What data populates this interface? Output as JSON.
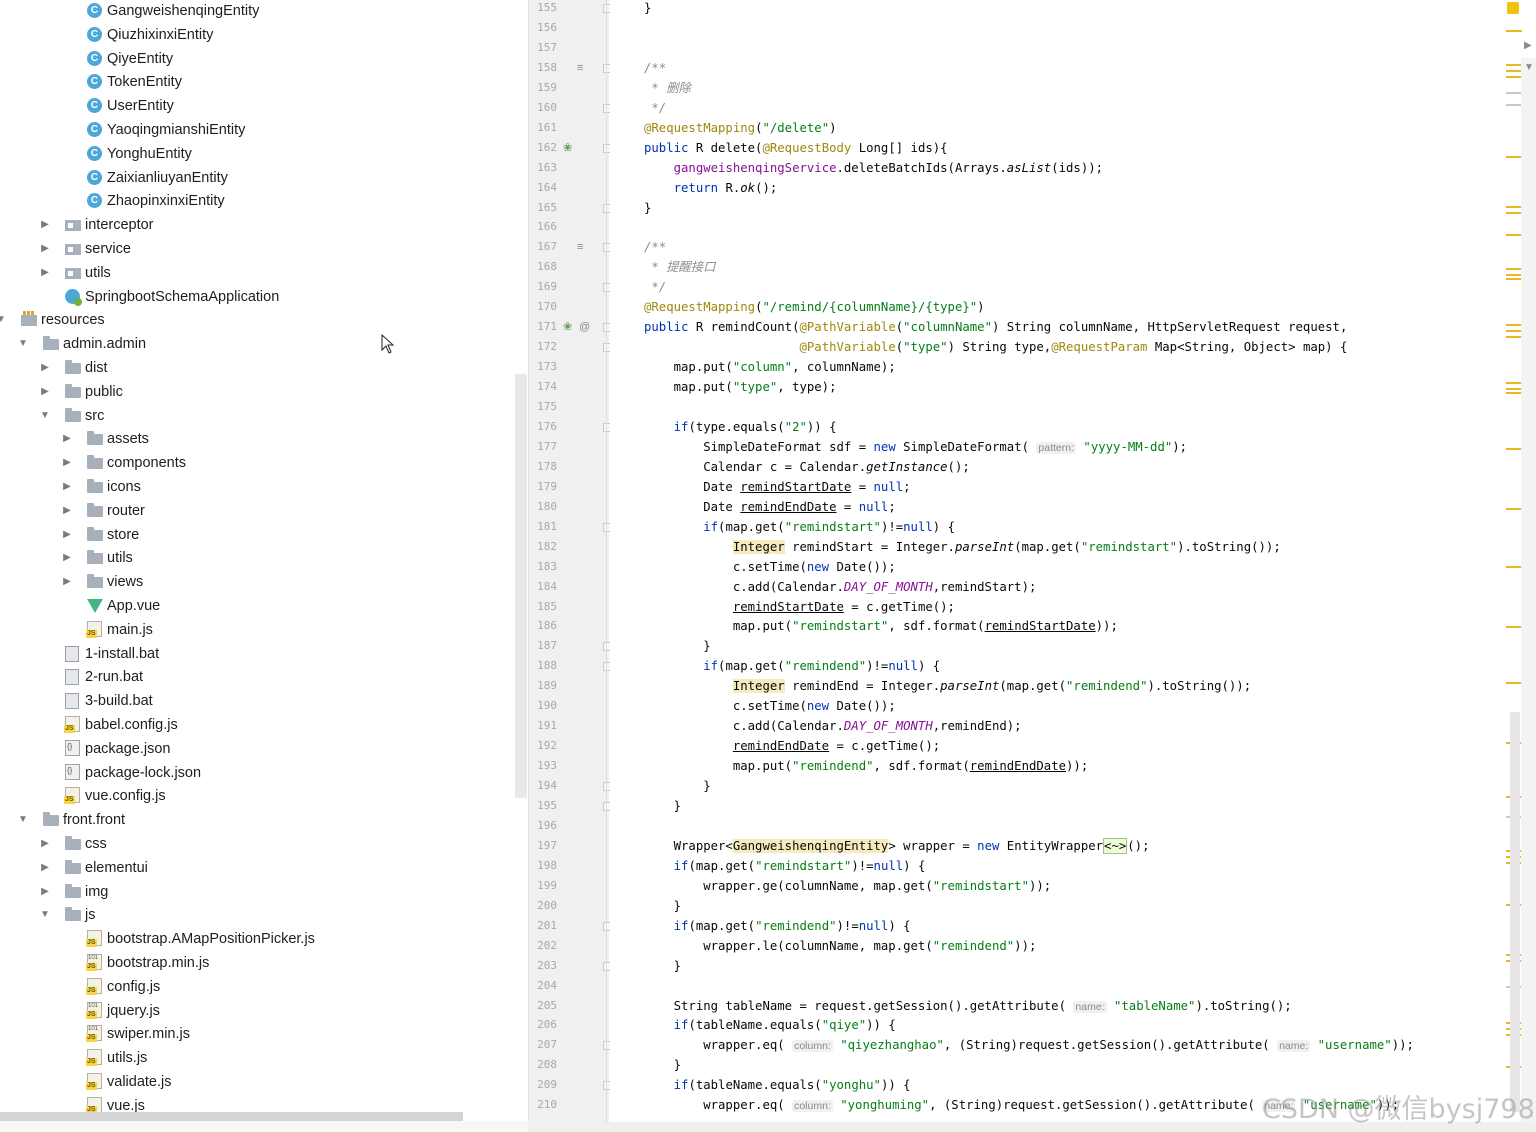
{
  "tree": {
    "rows": [
      {
        "label": "GangweishenqingEntity",
        "icon": "class-icon",
        "indent": 2,
        "arrow": ""
      },
      {
        "label": "QiuzhixinxiEntity",
        "icon": "class-icon",
        "indent": 2,
        "arrow": ""
      },
      {
        "label": "QiyeEntity",
        "icon": "class-icon",
        "indent": 2,
        "arrow": ""
      },
      {
        "label": "TokenEntity",
        "icon": "class-icon",
        "indent": 2,
        "arrow": ""
      },
      {
        "label": "UserEntity",
        "icon": "class-icon",
        "indent": 2,
        "arrow": ""
      },
      {
        "label": "YaoqingmianshiEntity",
        "icon": "class-icon",
        "indent": 2,
        "arrow": ""
      },
      {
        "label": "YonghuEntity",
        "icon": "class-icon",
        "indent": 2,
        "arrow": ""
      },
      {
        "label": "ZaixianliuyanEntity",
        "icon": "class-icon",
        "indent": 2,
        "arrow": ""
      },
      {
        "label": "ZhaopinxinxiEntity",
        "icon": "class-icon",
        "indent": 2,
        "arrow": ""
      },
      {
        "label": "interceptor",
        "icon": "package-icon",
        "indent": 1,
        "arrow": "collapsed"
      },
      {
        "label": "service",
        "icon": "package-icon",
        "indent": 1,
        "arrow": "collapsed"
      },
      {
        "label": "utils",
        "icon": "package-icon",
        "indent": 1,
        "arrow": "collapsed"
      },
      {
        "label": "SpringbootSchemaApplication",
        "icon": "spring-app-icon",
        "indent": 1,
        "arrow": ""
      },
      {
        "label": "resources",
        "icon": "resources-folder-icon",
        "indent": -1,
        "arrow": "expanded"
      },
      {
        "label": "admin.admin",
        "icon": "folder-icon",
        "indent": 0,
        "arrow": "expanded"
      },
      {
        "label": "dist",
        "icon": "folder-icon",
        "indent": 1,
        "arrow": "collapsed"
      },
      {
        "label": "public",
        "icon": "folder-icon",
        "indent": 1,
        "arrow": "collapsed"
      },
      {
        "label": "src",
        "icon": "folder-icon",
        "indent": 1,
        "arrow": "expanded"
      },
      {
        "label": "assets",
        "icon": "folder-icon",
        "indent": 2,
        "arrow": "collapsed"
      },
      {
        "label": "components",
        "icon": "folder-icon",
        "indent": 2,
        "arrow": "collapsed"
      },
      {
        "label": "icons",
        "icon": "folder-icon",
        "indent": 2,
        "arrow": "collapsed"
      },
      {
        "label": "router",
        "icon": "folder-icon",
        "indent": 2,
        "arrow": "collapsed"
      },
      {
        "label": "store",
        "icon": "folder-icon",
        "indent": 2,
        "arrow": "collapsed"
      },
      {
        "label": "utils",
        "icon": "folder-icon",
        "indent": 2,
        "arrow": "collapsed"
      },
      {
        "label": "views",
        "icon": "folder-icon",
        "indent": 2,
        "arrow": "collapsed"
      },
      {
        "label": "App.vue",
        "icon": "vue-file-icon",
        "indent": 2,
        "arrow": ""
      },
      {
        "label": "main.js",
        "icon": "js-file-icon",
        "indent": 2,
        "arrow": ""
      },
      {
        "label": "1-install.bat",
        "icon": "bat-file-icon",
        "indent": 1,
        "arrow": ""
      },
      {
        "label": "2-run.bat",
        "icon": "bat-file-icon",
        "indent": 1,
        "arrow": ""
      },
      {
        "label": "3-build.bat",
        "icon": "bat-file-icon",
        "indent": 1,
        "arrow": ""
      },
      {
        "label": "babel.config.js",
        "icon": "js-file-icon",
        "indent": 1,
        "arrow": ""
      },
      {
        "label": "package.json",
        "icon": "json-file-icon",
        "indent": 1,
        "arrow": ""
      },
      {
        "label": "package-lock.json",
        "icon": "json-file-icon",
        "indent": 1,
        "arrow": ""
      },
      {
        "label": "vue.config.js",
        "icon": "js-file-icon",
        "indent": 1,
        "arrow": ""
      },
      {
        "label": "front.front",
        "icon": "folder-icon",
        "indent": 0,
        "arrow": "expanded"
      },
      {
        "label": "css",
        "icon": "folder-icon",
        "indent": 1,
        "arrow": "collapsed"
      },
      {
        "label": "elementui",
        "icon": "folder-icon",
        "indent": 1,
        "arrow": "collapsed"
      },
      {
        "label": "img",
        "icon": "folder-icon",
        "indent": 1,
        "arrow": "collapsed"
      },
      {
        "label": "js",
        "icon": "folder-icon",
        "indent": 1,
        "arrow": "expanded"
      },
      {
        "label": "bootstrap.AMapPositionPicker.js",
        "icon": "js-file-icon",
        "indent": 2,
        "arrow": ""
      },
      {
        "label": "bootstrap.min.js",
        "icon": "minified-js-icon",
        "indent": 2,
        "arrow": ""
      },
      {
        "label": "config.js",
        "icon": "js-file-icon",
        "indent": 2,
        "arrow": ""
      },
      {
        "label": "jquery.js",
        "icon": "minified-js-icon",
        "indent": 2,
        "arrow": ""
      },
      {
        "label": "swiper.min.js",
        "icon": "minified-js-icon",
        "indent": 2,
        "arrow": ""
      },
      {
        "label": "utils.js",
        "icon": "js-file-icon",
        "indent": 2,
        "arrow": ""
      },
      {
        "label": "validate.js",
        "icon": "js-file-icon",
        "indent": 2,
        "arrow": ""
      },
      {
        "label": "vue.js",
        "icon": "js-file-icon",
        "indent": 2,
        "arrow": ""
      }
    ]
  },
  "editor": {
    "line_numbers": [
      "155",
      "156",
      "157",
      "158",
      "159",
      "160",
      "161",
      "162",
      "163",
      "164",
      "165",
      "166",
      "167",
      "168",
      "169",
      "170",
      "171",
      "172",
      "173",
      "174",
      "175",
      "176",
      "177",
      "178",
      "179",
      "180",
      "181",
      "182",
      "183",
      "184",
      "185",
      "186",
      "187",
      "188",
      "189",
      "190",
      "191",
      "192",
      "193",
      "194",
      "195",
      "196",
      "197",
      "198",
      "199",
      "200",
      "201",
      "202",
      "203",
      "204",
      "205",
      "206",
      "207",
      "208",
      "209",
      "210"
    ],
    "gutter_marks": {
      "158": "doc-icon",
      "162": "bean-icon",
      "167": "doc-icon",
      "171": "bean-icon"
    },
    "lines": [
      [
        [
          "}",
          ""
        ]
      ],
      [],
      [],
      [
        [
          "/**",
          "cm"
        ]
      ],
      [
        [
          " * 删除",
          "cm"
        ]
      ],
      [
        [
          " */",
          "cm"
        ]
      ],
      [
        [
          "@RequestMapping",
          "an"
        ],
        [
          "(",
          ""
        ],
        [
          "\"/delete\"",
          "st"
        ],
        [
          ")",
          ""
        ]
      ],
      [
        [
          "public ",
          "kw"
        ],
        [
          "R delete(",
          ""
        ],
        [
          "@RequestBody ",
          "an"
        ],
        [
          "Long[] ids){",
          ""
        ]
      ],
      [
        [
          "    ",
          ""
        ],
        [
          "gangweishenqingService",
          "fd"
        ],
        [
          ".deleteBatchIds(Arrays.",
          ""
        ],
        [
          "asList",
          "it"
        ],
        [
          "(ids));",
          ""
        ]
      ],
      [
        [
          "    ",
          ""
        ],
        [
          "return ",
          "kw"
        ],
        [
          "R.",
          ""
        ],
        [
          "ok",
          "it"
        ],
        [
          "();",
          ""
        ]
      ],
      [
        [
          "}",
          ""
        ]
      ],
      [],
      [
        [
          "/**",
          "cm"
        ]
      ],
      [
        [
          " * 提醒接口",
          "cm"
        ]
      ],
      [
        [
          " */",
          "cm"
        ]
      ],
      [
        [
          "@RequestMapping",
          "an"
        ],
        [
          "(",
          ""
        ],
        [
          "\"/remind/{columnName}/{type}\"",
          "st"
        ],
        [
          ")",
          ""
        ]
      ],
      [
        [
          "public ",
          "kw"
        ],
        [
          "R remindCount(",
          ""
        ],
        [
          "@PathVariable",
          "an"
        ],
        [
          "(",
          ""
        ],
        [
          "\"columnName\"",
          "st"
        ],
        [
          ") String columnName, HttpServletRequest request,",
          ""
        ]
      ],
      [
        [
          "                     ",
          ""
        ],
        [
          "@PathVariable",
          "an"
        ],
        [
          "(",
          ""
        ],
        [
          "\"type\"",
          "st"
        ],
        [
          ") String type,",
          ""
        ],
        [
          "@RequestParam ",
          "an"
        ],
        [
          "Map<String, Object> map) {",
          ""
        ]
      ],
      [
        [
          "    map.put(",
          ""
        ],
        [
          "\"column\"",
          "st"
        ],
        [
          ", columnName);",
          ""
        ]
      ],
      [
        [
          "    map.put(",
          ""
        ],
        [
          "\"type\"",
          "st"
        ],
        [
          ", type);",
          ""
        ]
      ],
      [],
      [
        [
          "    ",
          ""
        ],
        [
          "if",
          "kw"
        ],
        [
          "(type.equals(",
          ""
        ],
        [
          "\"2\"",
          "st"
        ],
        [
          ")) {",
          ""
        ]
      ],
      [
        [
          "        SimpleDateFormat sdf = ",
          ""
        ],
        [
          "new ",
          "kw"
        ],
        [
          "SimpleDateFormat( ",
          ""
        ],
        [
          "pattern:",
          "hint"
        ],
        [
          " ",
          ""
        ],
        [
          "\"yyyy-MM-dd\"",
          "st"
        ],
        [
          ");",
          ""
        ]
      ],
      [
        [
          "        Calendar c = Calendar.",
          ""
        ],
        [
          "getInstance",
          "it"
        ],
        [
          "();",
          ""
        ]
      ],
      [
        [
          "        Date ",
          ""
        ],
        [
          "remindStartDate",
          "ul"
        ],
        [
          " = ",
          ""
        ],
        [
          "null",
          "kw"
        ],
        [
          ";",
          ""
        ]
      ],
      [
        [
          "        Date ",
          ""
        ],
        [
          "remindEndDate",
          "ul"
        ],
        [
          " = ",
          ""
        ],
        [
          "null",
          "kw"
        ],
        [
          ";",
          ""
        ]
      ],
      [
        [
          "        ",
          ""
        ],
        [
          "if",
          "kw"
        ],
        [
          "(map.get(",
          ""
        ],
        [
          "\"remindstart\"",
          "st"
        ],
        [
          ")!=",
          ""
        ],
        [
          "null",
          "kw"
        ],
        [
          ") {",
          ""
        ]
      ],
      [
        [
          "            ",
          ""
        ],
        [
          "Integer",
          "hl"
        ],
        [
          " remindStart = Integer.",
          ""
        ],
        [
          "parseInt",
          "it"
        ],
        [
          "(map.get(",
          ""
        ],
        [
          "\"remindstart\"",
          "st"
        ],
        [
          ").toString());",
          ""
        ]
      ],
      [
        [
          "            c.setTime(",
          ""
        ],
        [
          "new ",
          "kw"
        ],
        [
          "Date());",
          ""
        ]
      ],
      [
        [
          "            c.add(Calendar.",
          ""
        ],
        [
          "DAY_OF_MONTH",
          "ct"
        ],
        [
          ",remindStart);",
          ""
        ]
      ],
      [
        [
          "            ",
          ""
        ],
        [
          "remindStartDate",
          "ul"
        ],
        [
          " = c.getTime();",
          ""
        ]
      ],
      [
        [
          "            map.put(",
          ""
        ],
        [
          "\"remindstart\"",
          "st"
        ],
        [
          ", sdf.format(",
          ""
        ],
        [
          "remindStartDate",
          "ul"
        ],
        [
          "));",
          ""
        ]
      ],
      [
        [
          "        }",
          ""
        ]
      ],
      [
        [
          "        ",
          ""
        ],
        [
          "if",
          "kw"
        ],
        [
          "(map.get(",
          ""
        ],
        [
          "\"remindend\"",
          "st"
        ],
        [
          ")!=",
          ""
        ],
        [
          "null",
          "kw"
        ],
        [
          ") {",
          ""
        ]
      ],
      [
        [
          "            ",
          ""
        ],
        [
          "Integer",
          "hl"
        ],
        [
          " remindEnd = Integer.",
          ""
        ],
        [
          "parseInt",
          "it"
        ],
        [
          "(map.get(",
          ""
        ],
        [
          "\"remindend\"",
          "st"
        ],
        [
          ").toString());",
          ""
        ]
      ],
      [
        [
          "            c.setTime(",
          ""
        ],
        [
          "new ",
          "kw"
        ],
        [
          "Date());",
          ""
        ]
      ],
      [
        [
          "            c.add(Calendar.",
          ""
        ],
        [
          "DAY_OF_MONTH",
          "ct"
        ],
        [
          ",remindEnd);",
          ""
        ]
      ],
      [
        [
          "            ",
          ""
        ],
        [
          "remindEndDate",
          "ul"
        ],
        [
          " = c.getTime();",
          ""
        ]
      ],
      [
        [
          "            map.put(",
          ""
        ],
        [
          "\"remindend\"",
          "st"
        ],
        [
          ", sdf.format(",
          ""
        ],
        [
          "remindEndDate",
          "ul"
        ],
        [
          "));",
          ""
        ]
      ],
      [
        [
          "        }",
          ""
        ]
      ],
      [
        [
          "    }",
          ""
        ]
      ],
      [],
      [
        [
          "    Wrapper<",
          ""
        ],
        [
          "GangweishenqingEntity",
          "hl"
        ],
        [
          "> wrapper = ",
          ""
        ],
        [
          "new ",
          "kw"
        ],
        [
          "EntityWrapper",
          ""
        ],
        [
          "<~>",
          "typeq"
        ],
        [
          "();",
          ""
        ]
      ],
      [
        [
          "    ",
          ""
        ],
        [
          "if",
          "kw"
        ],
        [
          "(map.get(",
          ""
        ],
        [
          "\"remindstart\"",
          "st"
        ],
        [
          ")!=",
          ""
        ],
        [
          "null",
          "kw"
        ],
        [
          ") {",
          ""
        ]
      ],
      [
        [
          "        wrapper.ge(columnName, map.get(",
          ""
        ],
        [
          "\"remindstart\"",
          "st"
        ],
        [
          "));",
          ""
        ]
      ],
      [
        [
          "    }",
          ""
        ]
      ],
      [
        [
          "    ",
          ""
        ],
        [
          "if",
          "kw"
        ],
        [
          "(map.get(",
          ""
        ],
        [
          "\"remindend\"",
          "st"
        ],
        [
          ")!=",
          ""
        ],
        [
          "null",
          "kw"
        ],
        [
          ") {",
          ""
        ]
      ],
      [
        [
          "        wrapper.le(columnName, map.get(",
          ""
        ],
        [
          "\"remindend\"",
          "st"
        ],
        [
          "));",
          ""
        ]
      ],
      [
        [
          "    }",
          ""
        ]
      ],
      [],
      [
        [
          "    String tableName = request.getSession().getAttribute( ",
          ""
        ],
        [
          "name:",
          "hint"
        ],
        [
          " ",
          ""
        ],
        [
          "\"tableName\"",
          "st"
        ],
        [
          ").toString();",
          ""
        ]
      ],
      [
        [
          "    ",
          ""
        ],
        [
          "if",
          "kw"
        ],
        [
          "(tableName.equals(",
          ""
        ],
        [
          "\"qiye\"",
          "st"
        ],
        [
          ")) {",
          ""
        ]
      ],
      [
        [
          "        wrapper.eq( ",
          ""
        ],
        [
          "column:",
          "hint"
        ],
        [
          " ",
          ""
        ],
        [
          "\"qiyezhanghao\"",
          "st"
        ],
        [
          ", (String)request.getSession().getAttribute( ",
          ""
        ],
        [
          "name:",
          "hint"
        ],
        [
          " ",
          ""
        ],
        [
          "\"username\"",
          "st"
        ],
        [
          "));",
          ""
        ]
      ],
      [
        [
          "    }",
          ""
        ]
      ],
      [
        [
          "    ",
          ""
        ],
        [
          "if",
          "kw"
        ],
        [
          "(tableName.equals(",
          ""
        ],
        [
          "\"yonghu\"",
          "st"
        ],
        [
          ")) {",
          ""
        ]
      ],
      [
        [
          "        wrapper.eq( ",
          ""
        ],
        [
          "column:",
          "hint"
        ],
        [
          " ",
          ""
        ],
        [
          "\"yonghuming\"",
          "st"
        ],
        [
          ", (String)request.getSession().getAttribute( ",
          ""
        ],
        [
          "name:",
          "hint"
        ],
        [
          " ",
          ""
        ],
        [
          "\"username\"",
          "st"
        ],
        [
          "));",
          ""
        ]
      ]
    ]
  },
  "watermark": "CSDN @微信bysj798",
  "colors": {
    "warning_marker": "#e8b825",
    "keyword": "#0033b3",
    "string": "#067d17",
    "annotation": "#9e880d"
  }
}
